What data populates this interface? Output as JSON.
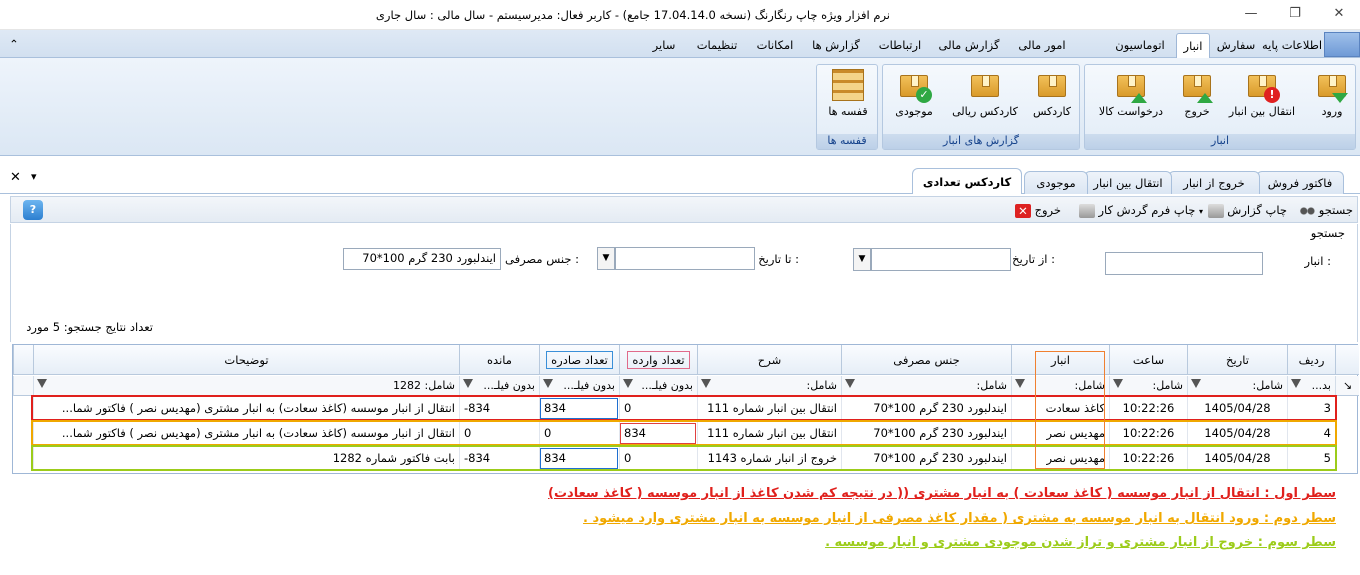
{
  "window": {
    "title": "نرم افزار ویژه چاپ رنگارنگ (نسخه 17.04.14.0 جامع) - کاربر فعال: مدیرسیستم - سال مالی : سال جاری",
    "minimize": "—",
    "restore": "❐",
    "close": "✕"
  },
  "menu": {
    "tabs": [
      "اطلاعات پایه",
      "سفارش",
      "انبار",
      "اتوماسیون",
      "امور مالی",
      "گزارش مالی",
      "ارتباطات",
      "گزارش ها",
      "امکانات",
      "تنظیمات",
      "سایر"
    ],
    "active": "انبار",
    "collapse": "⌃"
  },
  "ribbon": {
    "group1_title": "انبار",
    "group1_buttons": [
      "ورود",
      "انتقال بین انبار",
      "خروج",
      "درخواست کالا"
    ],
    "group2_title": "گزارش های انبار",
    "group2_buttons": [
      "کاردکس",
      "کاردکس ریالی",
      "موجودی"
    ],
    "group3_title": "قفسه ها",
    "group3_buttons": [
      "قفسه ها"
    ]
  },
  "doc_tabs": {
    "tabs": [
      "فاکتور فروش",
      "خروج از انبار",
      "انتقال بین انبار",
      "موجودی",
      "کاردکس تعدادی"
    ],
    "active": "کاردکس تعدادی",
    "close": "✕",
    "menu": "▾"
  },
  "toolbar": {
    "search": "جستجو",
    "print_report": "چاپ گزارش",
    "print_form": "چاپ فرم گردش کار",
    "exit": "خروج"
  },
  "search_panel": {
    "caption": "جستجو",
    "warehouse_label": "انبار :",
    "warehouse_value": "",
    "from_date_label": "از تاریخ :",
    "from_date_value": "",
    "to_date_label": "تا تاریخ :",
    "to_date_value": "",
    "material_label": "جنس مصرفی :",
    "material_value": "ایندلبورد  230 گرم  100*70",
    "result_count": "تعداد نتایج جستجو: 5 مورد"
  },
  "grid": {
    "columns": [
      "ردیف",
      "تاریخ",
      "ساعت",
      "انبار",
      "جنس مصرفی",
      "شرح",
      "تعداد وارده",
      "تعداد صادره",
      "مانده",
      "توضیحات"
    ],
    "filters": [
      "بد...",
      "شامل:",
      "شامل:",
      "شامل:",
      "شامل:",
      "شامل:",
      "بدون فیلـ...",
      "بدون فیلـ...",
      "بدون فیلـ...",
      "شامل: 1282"
    ],
    "rows": [
      {
        "row": "3",
        "date": "1405/04/28",
        "time": "10:22:26",
        "warehouse": "کاغذ سعادت",
        "material": "ایندلبورد  230 گرم  100*70",
        "desc": "انتقال بین انبار شماره 111",
        "in": "0",
        "out": "834",
        "balance": "-834",
        "notes": "انتقال از انبار موسسه (کاغذ سعادت) به انبار مشتری (مهدیس نصر ) فاکتور شما..."
      },
      {
        "row": "4",
        "date": "1405/04/28",
        "time": "10:22:26",
        "warehouse": "مهدیس نصر",
        "material": "ایندلبورد  230 گرم  100*70",
        "desc": "انتقال بین انبار شماره 111",
        "in": "834",
        "out": "0",
        "balance": "0",
        "notes": "انتقال از انبار موسسه (کاغذ سعادت) به انبار مشتری (مهدیس نصر ) فاکتور شما..."
      },
      {
        "row": "5",
        "date": "1405/04/28",
        "time": "10:22:26",
        "warehouse": "مهدیس نصر",
        "material": "ایندلبورد  230 گرم  100*70",
        "desc": "خروج از انبار شماره 1143",
        "in": "0",
        "out": "834",
        "balance": "-834",
        "notes": "بابت فاکتور شماره 1282"
      }
    ]
  },
  "notes": {
    "line1": "سطر اول : انتقال از انبار موسسه ( کاغذ سعادت ) به انبار مشتری (( در نتیجه کم شدن کاغذ از انبار موسسه ( کاغذ سعادت)",
    "line2": "سطر دوم : ورود انتقال به انبار موسسه به مشتری ( مقدار کاغذ مصرفی از انبار موسسه به انبار مشتری وارد میشود .",
    "line3": "سطر سوم : خروج از انبار مشتری و تراز شدن موجودی مشتری و انبار موسسه .",
    "color1": "#e0201c",
    "color2": "#f0a800",
    "color3": "#9ccc1a"
  }
}
